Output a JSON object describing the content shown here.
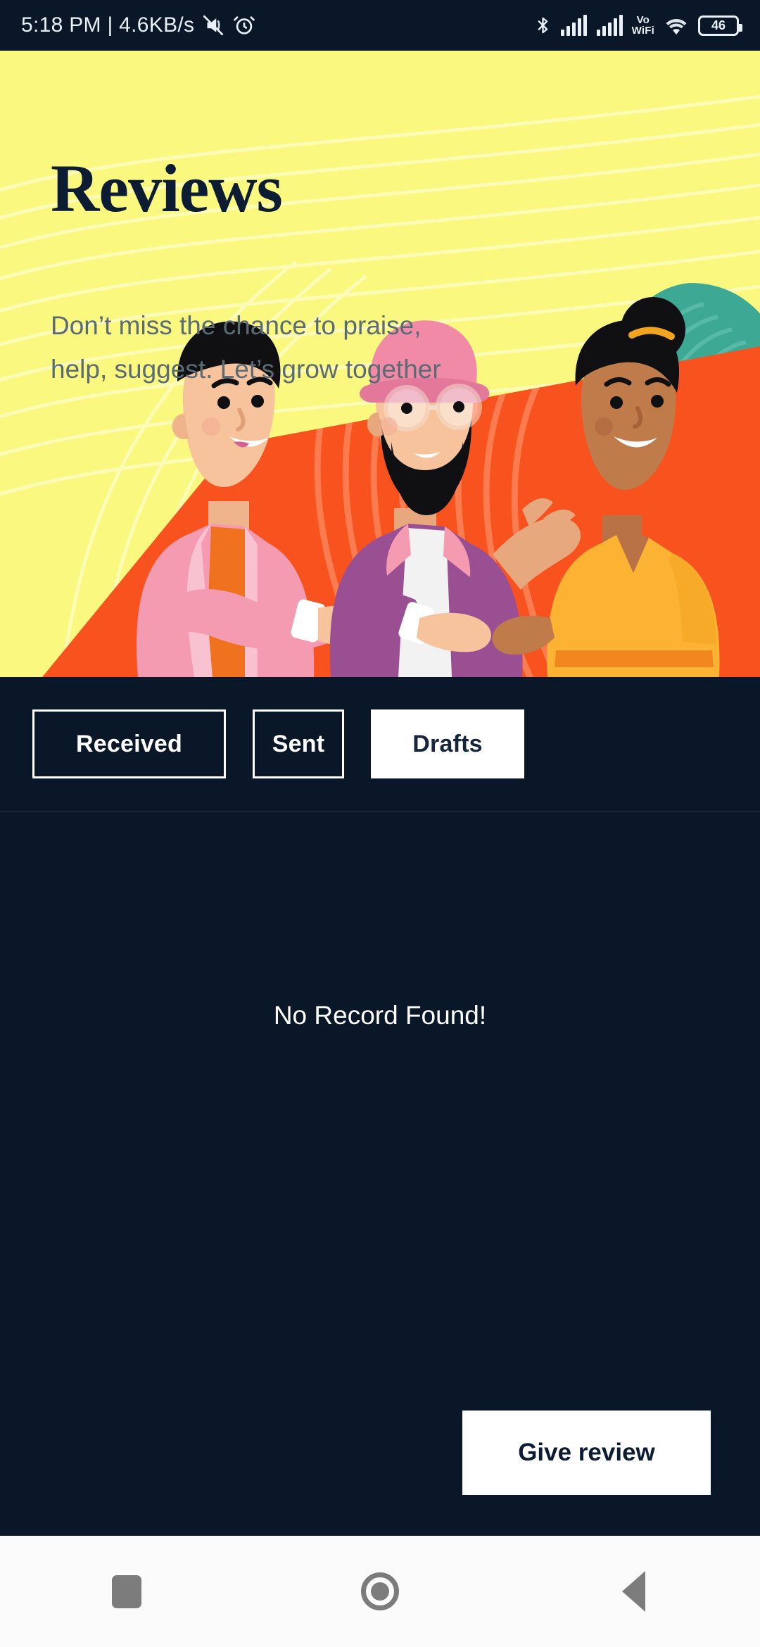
{
  "statusbar": {
    "time_text": "5:18 PM | 4.6KB/s",
    "icons": [
      "mute-icon",
      "alarm-icon",
      "bluetooth-icon",
      "signal-bars-icon",
      "signal-bars-2-icon",
      "volte-wifi-icon",
      "wifi-icon",
      "battery-icon"
    ],
    "volte_line1": "Vo",
    "volte_line2": "WiFi",
    "battery_level": "46"
  },
  "hero": {
    "title": "Reviews",
    "subtitle": "Don’t miss the chance to praise, help, suggest. Let’s grow together",
    "bg_color": "#faf87f",
    "title_color": "#0c1c33",
    "subtitle_color": "#5b6b75",
    "illustration": "three-people-talking-illustration"
  },
  "tabs": [
    {
      "label": "Received",
      "active": false
    },
    {
      "label": "Sent",
      "active": false
    },
    {
      "label": "Drafts",
      "active": true
    }
  ],
  "content": {
    "empty_message": "No Record Found!",
    "bg_color": "#0a1728"
  },
  "actions": {
    "give_review_label": "Give review"
  },
  "navbar": {
    "recent_label": "recent-apps",
    "home_label": "home",
    "back_label": "back"
  }
}
